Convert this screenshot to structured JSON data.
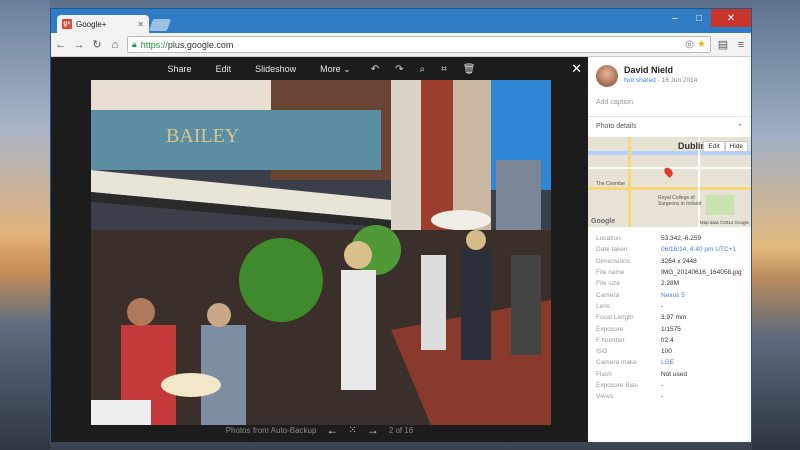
{
  "browser": {
    "tab_title": "Google+",
    "favicon_text": "g+",
    "url_secure": "https://",
    "url_rest": "plus.google.com"
  },
  "viewer": {
    "toolbar": {
      "share": "Share",
      "edit": "Edit",
      "slideshow": "Slideshow",
      "more": "More"
    },
    "bottom": {
      "source": "Photos from Auto-Backup",
      "counter": "2 of 16"
    },
    "photo_sign": "BAILEY"
  },
  "panel": {
    "owner_name": "David Nield",
    "share_status": "Not shared",
    "date": "16 Jun 2014",
    "add_caption": "Add caption",
    "photo_details_label": "Photo details",
    "map": {
      "city_label": "Dublin",
      "edit_label": "Edit",
      "hide_label": "Hide",
      "footer": "Map data ©2014 Google",
      "college_label": "Royal College of Surgeons in Ireland",
      "coombe_label": "The Coombe",
      "google_logo": "Google"
    },
    "details": [
      {
        "label": "Location",
        "value": "53.342,-6.259",
        "link": false
      },
      {
        "label": "Date taken",
        "value": "06/16/14, 4:40 pm UTC+1",
        "link": true
      },
      {
        "label": "Dimensions",
        "value": "3264 x 2448",
        "link": false
      },
      {
        "label": "File name",
        "value": "IMG_20140616_164058.jpg",
        "link": false
      },
      {
        "label": "File size",
        "value": "2.28M",
        "link": false
      },
      {
        "label": "Camera",
        "value": "Nexus 5",
        "link": true
      },
      {
        "label": "Lens",
        "value": "-",
        "link": false
      },
      {
        "label": "Focal Length",
        "value": "3.97 mm",
        "link": false
      },
      {
        "label": "Exposure",
        "value": "1/1575",
        "link": false
      },
      {
        "label": "F Number",
        "value": "f/2.4",
        "link": false
      },
      {
        "label": "ISO",
        "value": "100",
        "link": false
      },
      {
        "label": "Camera make",
        "value": "LGE",
        "link": true
      },
      {
        "label": "Flash",
        "value": "Not used",
        "link": false
      },
      {
        "label": "Exposure Bias",
        "value": "-",
        "link": false
      },
      {
        "label": "Views",
        "value": "-",
        "link": false
      }
    ]
  }
}
